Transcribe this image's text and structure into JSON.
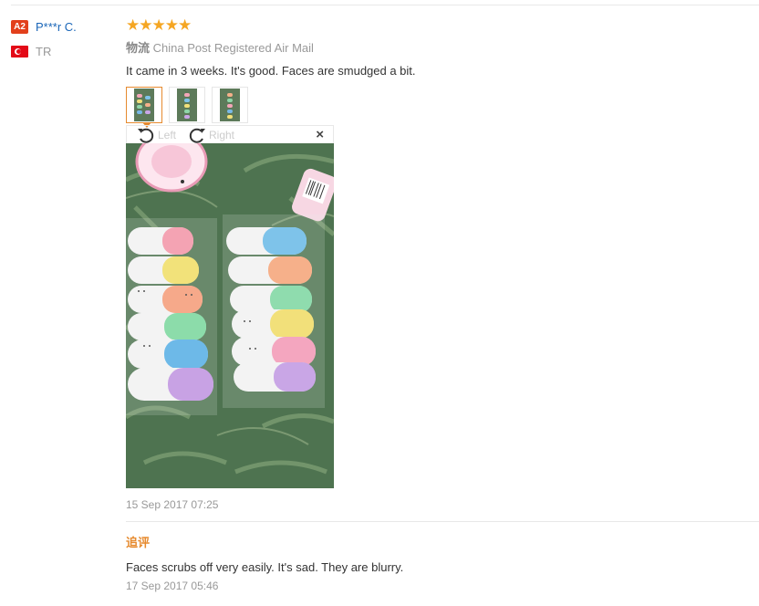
{
  "user": {
    "level_badge": "A2",
    "name": "P***r C.",
    "country_code": "TR"
  },
  "review": {
    "stars": 5,
    "star_glyph": "★",
    "shipping_label": "物流",
    "shipping_method": "China Post Registered Air Mail",
    "comment": "It came in 3 weeks. It's good. Faces are smudged a bit.",
    "thumbnail_count": 3,
    "viewer": {
      "rotate_left_label": "Left",
      "rotate_right_label": "Right",
      "close_glyph": "×"
    },
    "date": "15 Sep 2017 07:25"
  },
  "followup": {
    "label": "追评",
    "comment": "Faces scrubs off very easily. It's sad. They are blurry.",
    "date": "17 Sep 2017 05:46"
  },
  "colors": {
    "accent": "#e68a2e",
    "star": "#f5a623",
    "link": "#1a66b8",
    "badge": "#e2401c"
  }
}
